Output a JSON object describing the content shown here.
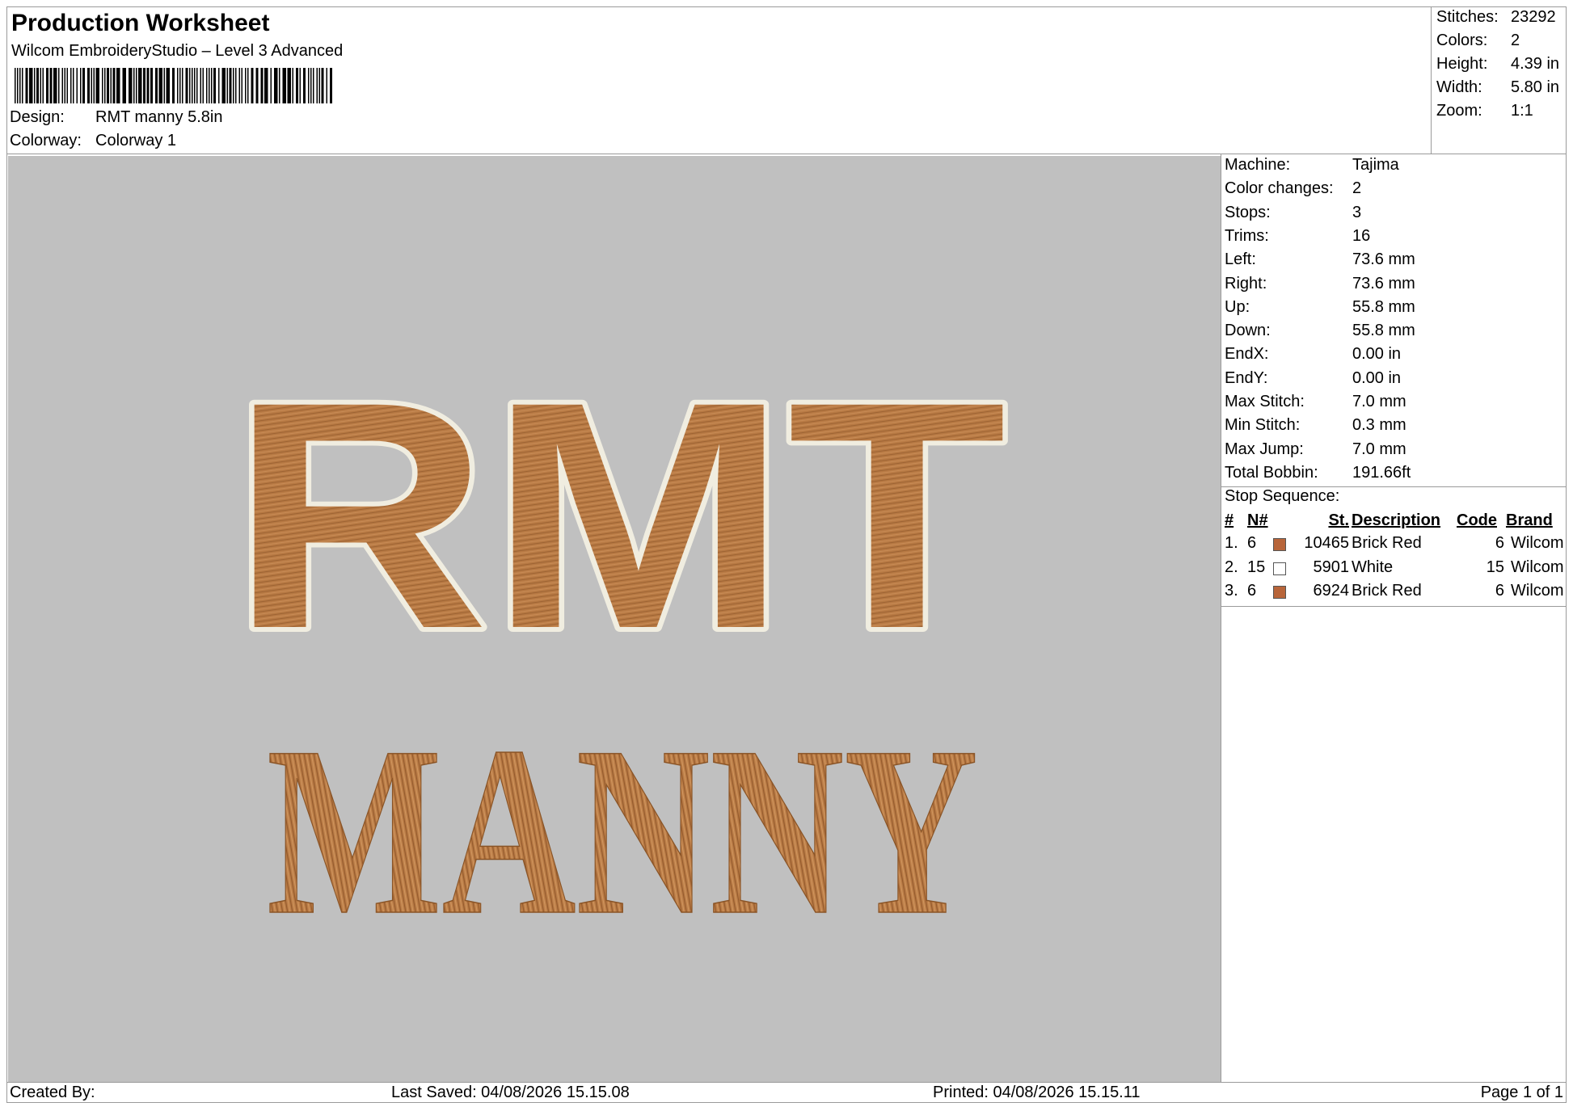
{
  "header": {
    "title": "Production Worksheet",
    "software": "Wilcom EmbroideryStudio – Level 3 Advanced",
    "design_label": "Design:",
    "design_value": "RMT manny 5.8in",
    "colorway_label": "Colorway:",
    "colorway_value": "Colorway 1"
  },
  "stats": [
    {
      "label": "Stitches:",
      "value": "23292"
    },
    {
      "label": "Colors:",
      "value": "2"
    },
    {
      "label": "Height:",
      "value": "4.39 in"
    },
    {
      "label": "Width:",
      "value": "5.80 in"
    },
    {
      "label": "Zoom:",
      "value": "1:1"
    }
  ],
  "preview": {
    "line1": "RMT",
    "line2": "MANNY",
    "thread_color": "#b87a44",
    "outline_color": "#f0ede0",
    "background_color": "#c0c0c0"
  },
  "machine_info": [
    {
      "label": "Machine:",
      "value": "Tajima"
    },
    {
      "label": "Color changes:",
      "value": "2"
    },
    {
      "label": "Stops:",
      "value": "3"
    },
    {
      "label": "Trims:",
      "value": "16"
    },
    {
      "label": "Left:",
      "value": "73.6 mm"
    },
    {
      "label": "Right:",
      "value": "73.6 mm"
    },
    {
      "label": "Up:",
      "value": "55.8 mm"
    },
    {
      "label": "Down:",
      "value": "55.8 mm"
    },
    {
      "label": "EndX:",
      "value": "0.00 in"
    },
    {
      "label": "EndY:",
      "value": "0.00 in"
    },
    {
      "label": "Max Stitch:",
      "value": "7.0 mm"
    },
    {
      "label": "Min Stitch:",
      "value": "0.3 mm"
    },
    {
      "label": "Max Jump:",
      "value": "7.0 mm"
    },
    {
      "label": "Total Bobbin:",
      "value": "191.66ft"
    }
  ],
  "stop_sequence": {
    "label": "Stop Sequence:",
    "headers": {
      "index": "#",
      "needle": "N#",
      "stitches": "St.",
      "description": "Description",
      "code": "Code",
      "brand": "Brand"
    },
    "rows": [
      {
        "index": "1.",
        "needle": "6",
        "color": "#b8653a",
        "stitches": "10465",
        "description": "Brick Red",
        "code": "6",
        "brand": "Wilcom"
      },
      {
        "index": "2.",
        "needle": "15",
        "color": "#ffffff",
        "stitches": "5901",
        "description": "White",
        "code": "15",
        "brand": "Wilcom"
      },
      {
        "index": "3.",
        "needle": "6",
        "color": "#b8653a",
        "stitches": "6924",
        "description": "Brick Red",
        "code": "6",
        "brand": "Wilcom"
      }
    ]
  },
  "footer": {
    "created_by": "Created By:",
    "last_saved": "Last Saved: 04/08/2026 15.15.08",
    "printed": "Printed: 04/08/2026 15.15.11",
    "page": "Page 1 of 1"
  }
}
